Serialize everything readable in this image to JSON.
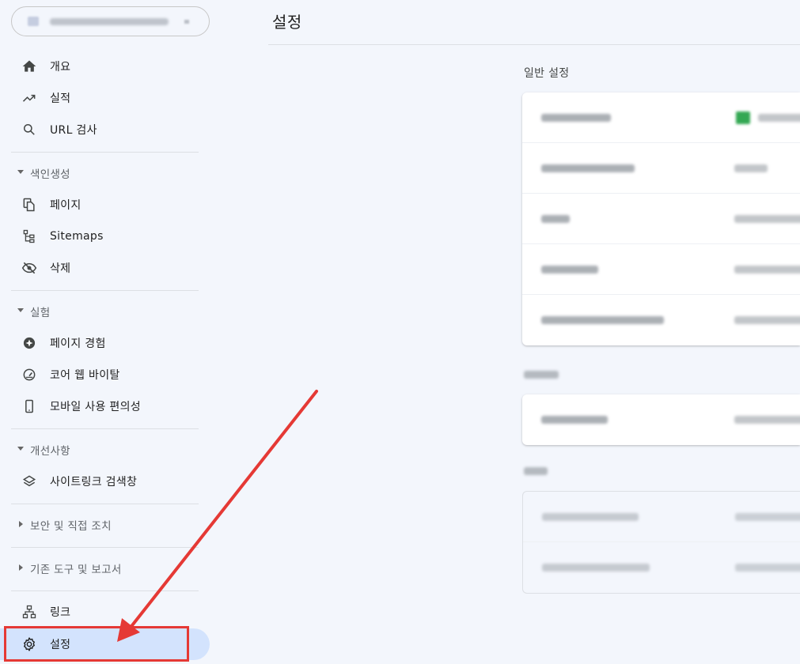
{
  "sidebar": {
    "nav_top": [
      {
        "label": "개요",
        "icon": "home-icon"
      },
      {
        "label": "실적",
        "icon": "trending-up-icon"
      },
      {
        "label": "URL 검사",
        "icon": "search-icon"
      }
    ],
    "sections": [
      {
        "label": "색인생성",
        "expanded": true,
        "items": [
          {
            "label": "페이지",
            "icon": "pages-icon"
          },
          {
            "label": "Sitemaps",
            "icon": "sitemap-icon"
          },
          {
            "label": "삭제",
            "icon": "visibility-off-icon"
          }
        ]
      },
      {
        "label": "실험",
        "expanded": true,
        "items": [
          {
            "label": "페이지 경험",
            "icon": "page-experience-icon"
          },
          {
            "label": "코어 웹 바이탈",
            "icon": "speed-gauge-icon"
          },
          {
            "label": "모바일 사용 편의성",
            "icon": "smartphone-icon"
          }
        ]
      },
      {
        "label": "개선사항",
        "expanded": true,
        "items": [
          {
            "label": "사이트링크 검색창",
            "icon": "layers-icon"
          }
        ]
      },
      {
        "label": "보안 및 직접 조치",
        "expanded": false,
        "items": []
      },
      {
        "label": "기존 도구 및 보고서",
        "expanded": false,
        "items": []
      }
    ],
    "nav_bottom": [
      {
        "label": "링크",
        "icon": "links-icon"
      },
      {
        "label": "설정",
        "icon": "gear-icon",
        "active": true
      }
    ]
  },
  "main": {
    "title": "설정",
    "general_section_title": "일반 설정"
  },
  "colors": {
    "background": "#f3f6fc",
    "active_item": "#d3e3fd",
    "annotation": "#e53935"
  }
}
